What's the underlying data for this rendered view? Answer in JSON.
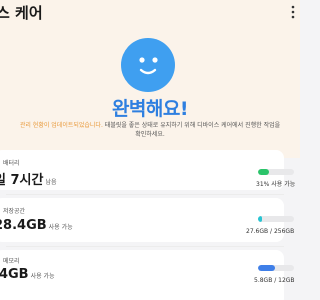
{
  "header": {
    "title": "스 케어",
    "menu_icon": "more-vertical-icon"
  },
  "status": {
    "face_icon": "smile-face-icon",
    "face_color": "#3f9ff0",
    "title": "완벽해요!",
    "desc_highlight": "관리 현황이 업데이트되었습니다.",
    "desc_line1": "태블릿을 좋은 상태로 유지하기 위해 디바이스 케어에서 진행한 작업을",
    "desc_line2": "확인하세요."
  },
  "battery": {
    "label": "배터리",
    "value": "일 7시간",
    "suffix": "남음",
    "note": "31% 사용 가능",
    "fill_percent": 31,
    "color": "#2bc46a"
  },
  "storage": {
    "label": "저장공간",
    "value": "28.4GB",
    "suffix": "사용 가능",
    "note": "27.6GB / 256GB",
    "fill_percent": 11,
    "color": "#27c4d2"
  },
  "memory": {
    "label": "메모리",
    "value": ".4GB",
    "suffix": "사용 가능",
    "note": "5.8GB / 12GB",
    "fill_percent": 48,
    "color": "#3f7fe8"
  }
}
